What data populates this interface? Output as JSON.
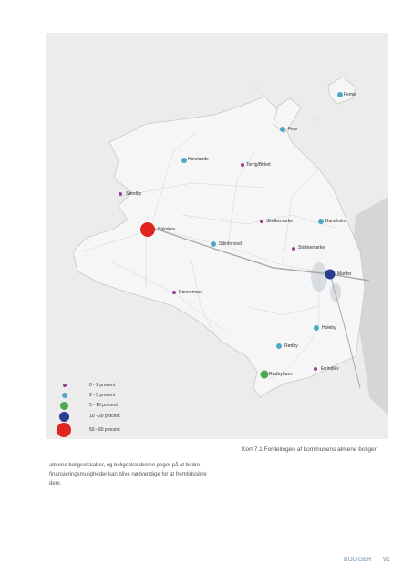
{
  "map": {
    "places": [
      {
        "name": "Femø",
        "category": "2-5"
      },
      {
        "name": "Fejø",
        "category": "2-5"
      },
      {
        "name": "Horslunde",
        "category": "2-5"
      },
      {
        "name": "Torrig/Birket",
        "category": "0-2"
      },
      {
        "name": "Søndby",
        "category": "0-2"
      },
      {
        "name": "Nakskov",
        "category": "50-60"
      },
      {
        "name": "Skelkemarke",
        "category": "0-2"
      },
      {
        "name": "Bandholm",
        "category": "2-5"
      },
      {
        "name": "Sdinforsiod",
        "category": "2-5"
      },
      {
        "name": "Stokkemarke",
        "category": "0-2"
      },
      {
        "name": "Maribo",
        "category": "10-20"
      },
      {
        "name": "Dannemare",
        "category": "0-2"
      },
      {
        "name": "Holeby",
        "category": "2-5"
      },
      {
        "name": "Rødby",
        "category": "2-5"
      },
      {
        "name": "Rødbyhavn",
        "category": "3-10"
      },
      {
        "name": "Errindlev",
        "category": "0-2"
      }
    ],
    "legend": [
      {
        "label": "0 -   2 procent",
        "color": "#9b3f8f",
        "category": "0-2"
      },
      {
        "label": "2 -   5 procent",
        "color": "#4fa8c8",
        "category": "2-5"
      },
      {
        "label": "5 - 10 procent",
        "color": "#4fa84a",
        "category": "3-10"
      },
      {
        "label": "10 - 20 procent",
        "color": "#2b3d8f",
        "category": "10-20"
      },
      {
        "label": "50 - 60 procent",
        "color": "#e0261f",
        "category": "50-60"
      }
    ]
  },
  "caption": "Kort 7.1 Fordelingen af kommunens almene boliger.",
  "body_text": "almene boligselskaber, og boligselskaberne peger på at bedre finansieringsmuligheder kan blive nødvendige for at fremtidssikre dem.",
  "footer": {
    "section": "BOLIGER",
    "page_number": "91"
  }
}
